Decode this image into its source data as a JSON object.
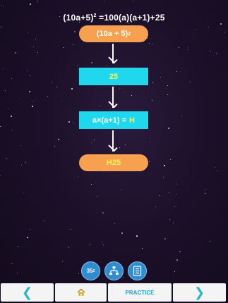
{
  "formula": {
    "lhs_base": "(10a+5)",
    "lhs_exp": "2",
    "rhs": "=100(a)(a+1)+25"
  },
  "flow": {
    "top_pill": {
      "base": "(10a  +  5)",
      "exp": "2"
    },
    "box_1": "25",
    "box_2_text": "a×(a+1)  =",
    "box_2_highlight": "H",
    "bottom_pill": "H25"
  },
  "tools": {
    "square_button": {
      "base": "35",
      "exp": "2"
    },
    "flowchart_icon": "flowchart-icon",
    "notes_icon": "notes-icon"
  },
  "nav": {
    "back_icon": "chevron-left-icon",
    "home_icon": "home-icon",
    "practice_label": "PRACTICE",
    "next_icon": "chevron-right-icon"
  },
  "colors": {
    "pill": "#f6a050",
    "box": "#1fd8ee",
    "highlight": "#fff85a",
    "tool_button": "#2f8dcf",
    "nav_accent": "#29b7c6"
  }
}
